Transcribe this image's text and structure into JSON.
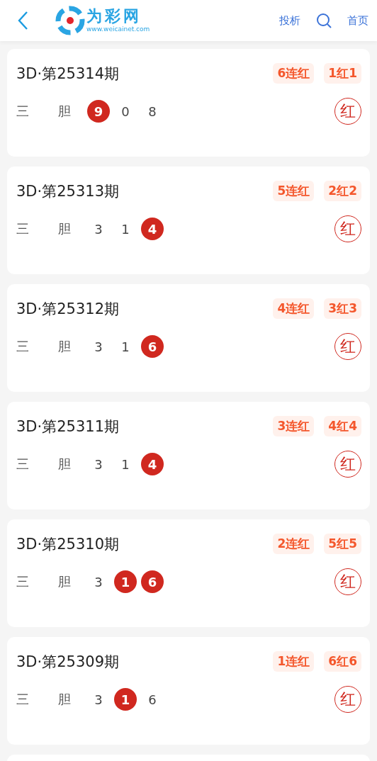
{
  "header": {
    "logo_title": "为彩网",
    "logo_url": "www.weicainet.com",
    "links": [
      "投析",
      "首页"
    ]
  },
  "cards": [
    {
      "title": "3D·第25314期",
      "tags": [
        "6连红",
        "1红1"
      ],
      "labels": [
        "三",
        "胆"
      ],
      "digits": [
        {
          "value": "9",
          "hit": true
        },
        {
          "value": "0",
          "hit": false
        },
        {
          "value": "8",
          "hit": false
        }
      ],
      "result": "红"
    },
    {
      "title": "3D·第25313期",
      "tags": [
        "5连红",
        "2红2"
      ],
      "labels": [
        "三",
        "胆"
      ],
      "digits": [
        {
          "value": "3",
          "hit": false
        },
        {
          "value": "1",
          "hit": false
        },
        {
          "value": "4",
          "hit": true
        }
      ],
      "result": "红"
    },
    {
      "title": "3D·第25312期",
      "tags": [
        "4连红",
        "3红3"
      ],
      "labels": [
        "三",
        "胆"
      ],
      "digits": [
        {
          "value": "3",
          "hit": false
        },
        {
          "value": "1",
          "hit": false
        },
        {
          "value": "6",
          "hit": true
        }
      ],
      "result": "红"
    },
    {
      "title": "3D·第25311期",
      "tags": [
        "3连红",
        "4红4"
      ],
      "labels": [
        "三",
        "胆"
      ],
      "digits": [
        {
          "value": "3",
          "hit": false
        },
        {
          "value": "1",
          "hit": false
        },
        {
          "value": "4",
          "hit": true
        }
      ],
      "result": "红"
    },
    {
      "title": "3D·第25310期",
      "tags": [
        "2连红",
        "5红5"
      ],
      "labels": [
        "三",
        "胆"
      ],
      "digits": [
        {
          "value": "3",
          "hit": false
        },
        {
          "value": "1",
          "hit": true
        },
        {
          "value": "6",
          "hit": true
        }
      ],
      "result": "红"
    },
    {
      "title": "3D·第25309期",
      "tags": [
        "1连红",
        "6红6"
      ],
      "labels": [
        "三",
        "胆"
      ],
      "digits": [
        {
          "value": "3",
          "hit": false
        },
        {
          "value": "1",
          "hit": true
        },
        {
          "value": "6",
          "hit": false
        }
      ],
      "result": "红"
    }
  ]
}
